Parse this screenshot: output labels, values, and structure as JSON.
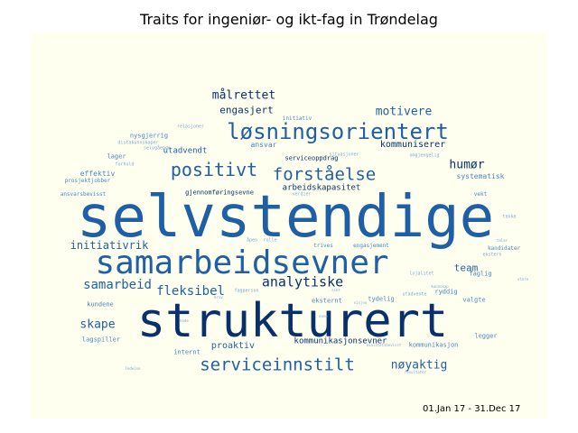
{
  "title": "Traits for ingeniør- og ikt-fag in Trøndelag",
  "date_range": "01.Jan 17 - 31.Dec 17",
  "colors": {
    "background": "#fffff0",
    "dark": "#08306b",
    "mid": "#1f5fa6",
    "light": "#4a86c0",
    "faint": "#7ba7d4"
  },
  "words": [
    {
      "text": "selvstendige",
      "weight": 64,
      "tone": "mid"
    },
    {
      "text": "strukturert",
      "weight": 52,
      "tone": "dark"
    },
    {
      "text": "samarbeidsevner",
      "weight": 36,
      "tone": "mid"
    },
    {
      "text": "løsningsorientert",
      "weight": 24,
      "tone": "mid"
    },
    {
      "text": "positivt",
      "weight": 20,
      "tone": "mid"
    },
    {
      "text": "forståelse",
      "weight": 19,
      "tone": "mid"
    },
    {
      "text": "serviceinnstilt",
      "weight": 19,
      "tone": "mid"
    },
    {
      "text": "analytiske",
      "weight": 15,
      "tone": "dark"
    },
    {
      "text": "samarbeid",
      "weight": 14,
      "tone": "mid"
    },
    {
      "text": "fleksibel",
      "weight": 14,
      "tone": "mid"
    },
    {
      "text": "målrettet",
      "weight": 13,
      "tone": "dark"
    },
    {
      "text": "motivere",
      "weight": 13,
      "tone": "mid"
    },
    {
      "text": "skape",
      "weight": 13,
      "tone": "mid"
    },
    {
      "text": "nøyaktig",
      "weight": 13,
      "tone": "mid"
    },
    {
      "text": "humør",
      "weight": 13,
      "tone": "dark"
    },
    {
      "text": "initiativrik",
      "weight": 12,
      "tone": "mid"
    },
    {
      "text": "team",
      "weight": 11,
      "tone": "mid"
    },
    {
      "text": "engasjert",
      "weight": 11,
      "tone": "dark"
    },
    {
      "text": "kommuniserer",
      "weight": 10,
      "tone": "dark"
    },
    {
      "text": "proaktiv",
      "weight": 10,
      "tone": "mid"
    },
    {
      "text": "kommunikasjonsevner",
      "weight": 9,
      "tone": "dark"
    },
    {
      "text": "arbeidskapasitet",
      "weight": 9,
      "tone": "dark"
    },
    {
      "text": "utadvendt",
      "weight": 9,
      "tone": "mid"
    },
    {
      "text": "ansvar",
      "weight": 8,
      "tone": "light"
    },
    {
      "text": "effektiv",
      "weight": 8,
      "tone": "light"
    },
    {
      "text": "systematisk",
      "weight": 8,
      "tone": "light"
    },
    {
      "text": "serviceoppdrag",
      "weight": 7,
      "tone": "dark"
    },
    {
      "text": "nysgjerrig",
      "weight": 7,
      "tone": "light"
    },
    {
      "text": "kundene",
      "weight": 7,
      "tone": "light"
    },
    {
      "text": "lagspiller",
      "weight": 7,
      "tone": "light"
    },
    {
      "text": "internt",
      "weight": 7,
      "tone": "light"
    },
    {
      "text": "legger",
      "weight": 7,
      "tone": "light"
    },
    {
      "text": "kommunikasjon",
      "weight": 7,
      "tone": "light"
    },
    {
      "text": "gjennomføringsevne",
      "weight": 7,
      "tone": "dark"
    },
    {
      "text": "lager",
      "weight": 7,
      "tone": "light"
    },
    {
      "text": "faglig",
      "weight": 7,
      "tone": "light"
    },
    {
      "text": "ryddig",
      "weight": 7,
      "tone": "light"
    },
    {
      "text": "valgte",
      "weight": 7,
      "tone": "light"
    },
    {
      "text": "tydelig",
      "weight": 7,
      "tone": "light"
    },
    {
      "text": "eksternt",
      "weight": 7,
      "tone": "light"
    },
    {
      "text": "engasjement",
      "weight": 6,
      "tone": "light"
    },
    {
      "text": "trives",
      "weight": 6,
      "tone": "light"
    },
    {
      "text": "kandidater",
      "weight": 6,
      "tone": "light"
    },
    {
      "text": "vekt",
      "weight": 6,
      "tone": "light"
    },
    {
      "text": "ansvarsbevisst",
      "weight": 6,
      "tone": "light"
    },
    {
      "text": "prosjektjobber",
      "weight": 6,
      "tone": "light"
    },
    {
      "text": "initiativ",
      "weight": 6,
      "tone": "light"
    },
    {
      "text": "forhold",
      "weight": 5,
      "tone": "faint"
    },
    {
      "text": "distakunnskaper",
      "weight": 5,
      "tone": "faint"
    },
    {
      "text": "selvgående",
      "weight": 5,
      "tone": "faint"
    },
    {
      "text": "relasjoner",
      "weight": 5,
      "tone": "faint"
    },
    {
      "text": "omgjengelig",
      "weight": 5,
      "tone": "faint"
    },
    {
      "text": "situasjoner",
      "weight": 5,
      "tone": "faint"
    },
    {
      "text": "verdier",
      "weight": 5,
      "tone": "faint"
    },
    {
      "text": "åpen",
      "weight": 5,
      "tone": "faint"
    },
    {
      "text": "rolle",
      "weight": 5,
      "tone": "faint"
    },
    {
      "text": "utadvente",
      "weight": 5,
      "tone": "faint"
    },
    {
      "text": "lojalitet",
      "weight": 5,
      "tone": "faint"
    },
    {
      "text": "ekstern",
      "weight": 5,
      "tone": "faint"
    },
    {
      "text": "tenke",
      "weight": 5,
      "tone": "faint"
    },
    {
      "text": "fagperson",
      "weight": 5,
      "tone": "faint"
    },
    {
      "text": "resultater",
      "weight": 4,
      "tone": "faint"
    },
    {
      "text": "ledelse",
      "weight": 4,
      "tone": "faint"
    },
    {
      "text": "kunnskap",
      "weight": 4,
      "tone": "faint"
    },
    {
      "text": "taler",
      "weight": 4,
      "tone": "faint"
    },
    {
      "text": "store",
      "weight": 4,
      "tone": "faint"
    },
    {
      "text": "sikt",
      "weight": 4,
      "tone": "faint"
    },
    {
      "text": "visjon",
      "weight": 4,
      "tone": "faint"
    },
    {
      "text": "evne",
      "weight": 4,
      "tone": "faint"
    },
    {
      "text": "krav",
      "weight": 4,
      "tone": "faint"
    },
    {
      "text": "kode",
      "weight": 4,
      "tone": "faint"
    },
    {
      "text": "kvalitetsbevisst",
      "weight": 4,
      "tone": "faint"
    }
  ]
}
